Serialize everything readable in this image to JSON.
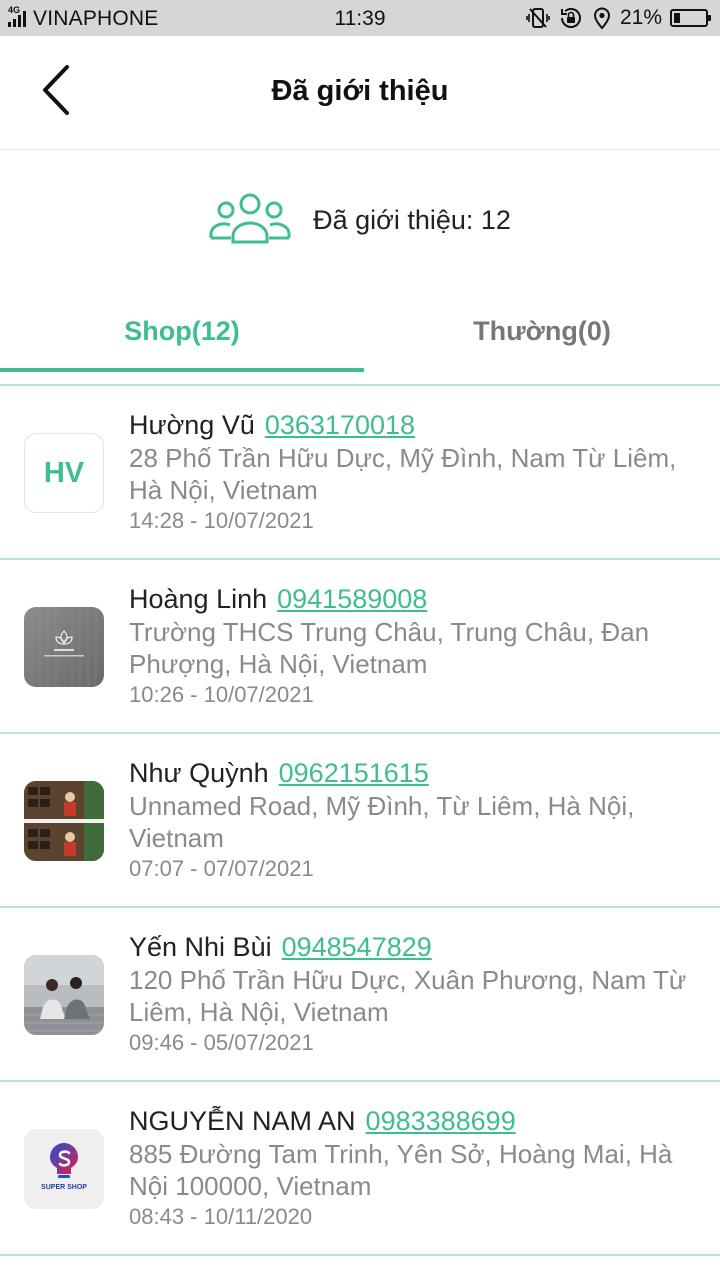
{
  "status_bar": {
    "network": "4G",
    "carrier": "VINAPHONE",
    "time": "11:39",
    "battery_percent": "21%",
    "battery_level": 0.21,
    "icons": [
      "vibrate-icon",
      "rotation-lock-icon",
      "location-icon",
      "battery-icon"
    ]
  },
  "header": {
    "back_icon": "chevron-left-icon",
    "title": "Đã giới thiệu"
  },
  "summary": {
    "icon": "users-group-icon",
    "text": "Đã giới thiệu: 12"
  },
  "tabs": [
    {
      "label": "Shop(12)",
      "active": true
    },
    {
      "label": "Thường(0)",
      "active": false
    }
  ],
  "colors": {
    "accent": "#3ebd93",
    "divider": "#b9e2d2",
    "secondary_text": "#8a8a8a"
  },
  "referrals": [
    {
      "name": "Hường Vũ",
      "phone": "0363170018",
      "address": "28 Phố Trần Hữu Dực, Mỹ Đình, Nam Từ Liêm, Hà Nội, Vietnam",
      "time": "14:28 - 10/07/2021",
      "avatar_initials": "HV"
    },
    {
      "name": "Hoàng Linh",
      "phone": "0941589008",
      "address": "Trường THCS Trung Châu, Trung Châu, Đan Phượng, Hà Nội, Vietnam",
      "time": "10:26 - 10/07/2021",
      "avatar_initials": ""
    },
    {
      "name": "Như Quỳnh",
      "phone": "0962151615",
      "address": "Unnamed Road, Mỹ Đình, Từ Liêm, Hà Nội, Vietnam",
      "time": "07:07 - 07/07/2021",
      "avatar_initials": ""
    },
    {
      "name": "Yến Nhi Bùi",
      "phone": "0948547829",
      "address": "120 Phố Trần Hữu Dực, Xuân Phương, Nam Từ Liêm, Hà Nội, Vietnam",
      "time": "09:46 - 05/07/2021",
      "avatar_initials": ""
    },
    {
      "name": "NGUYỄN NAM AN",
      "phone": "0983388699",
      "address": "885 Đường Tam Trinh, Yên Sở, Hoàng Mai, Hà Nội 100000, Vietnam",
      "time": "08:43 - 10/11/2020",
      "avatar_initials": "",
      "avatar_logo_text": "SUPER SHOP"
    }
  ]
}
